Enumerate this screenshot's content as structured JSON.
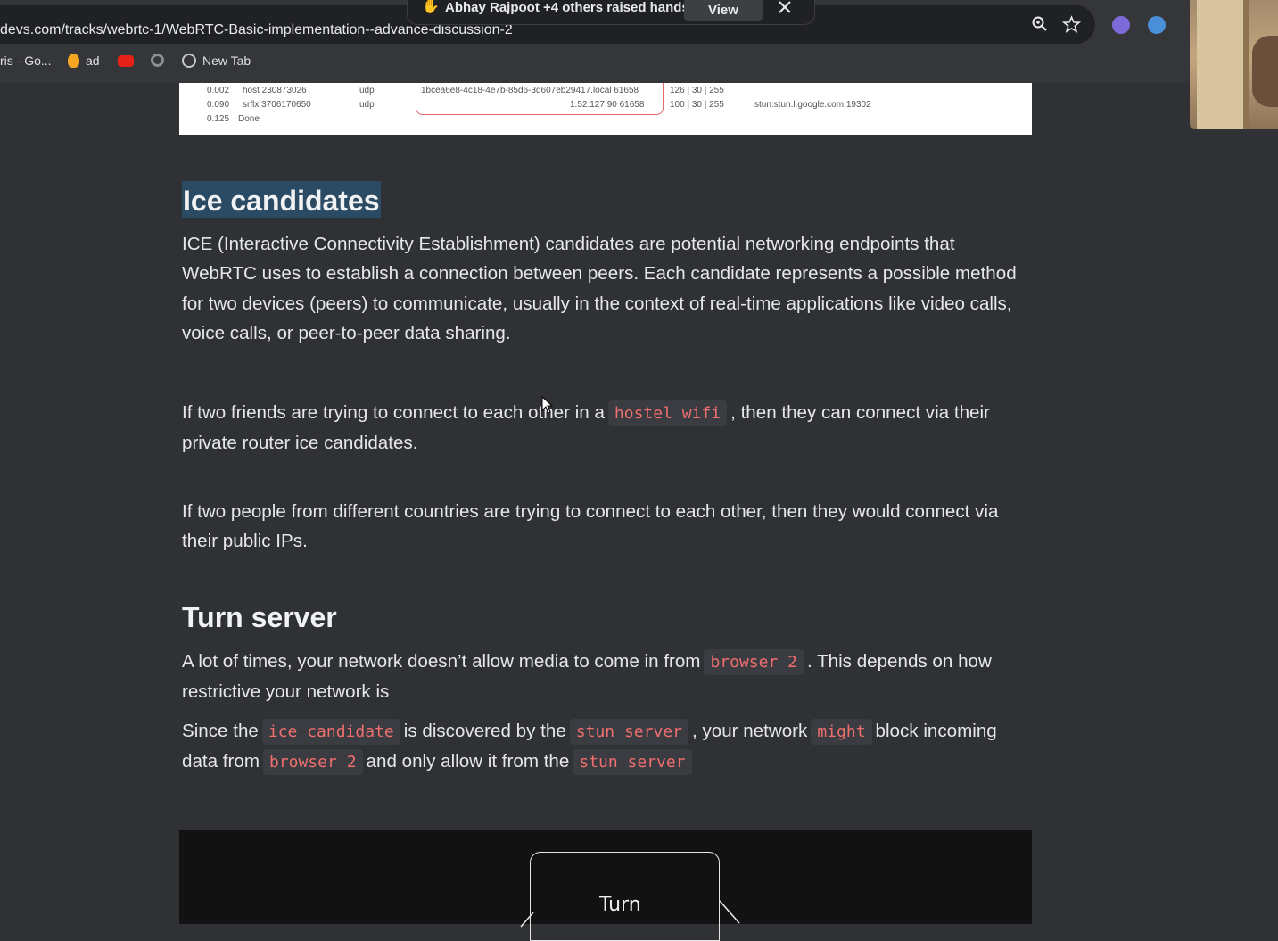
{
  "notification": {
    "text": "Abhay Rajpoot +4 others raised hands",
    "view_label": "View"
  },
  "browser": {
    "url": "devs.com/tracks/webrtc-1/WebRTC-Basic-implementation--advance-discussion-2",
    "bookmarks": [
      {
        "label": "ris - Go...",
        "icon": "bookmark-icon"
      },
      {
        "label": "ad",
        "icon": "flame-icon"
      },
      {
        "label": "",
        "icon": "youtube-icon"
      },
      {
        "label": "",
        "icon": "gear-icon"
      },
      {
        "label": "New Tab",
        "icon": "globe-icon"
      }
    ]
  },
  "ice_table": {
    "rows": [
      {
        "time": "0.002",
        "type": "host 230873026",
        "proto": "udp",
        "address": "1bcea6e8-4c18-4e7b-85d6-3d607eb29417.local 61658",
        "priority": "126 | 30 | 255",
        "server": ""
      },
      {
        "time": "0.090",
        "type": "srflx 3706170650",
        "proto": "udp",
        "address": "1.52.127.90 61658",
        "priority": "100 | 30 | 255",
        "server": "stun:stun.l.google.com:19302"
      },
      {
        "time": "0.125",
        "type": "Done",
        "proto": "",
        "address": "",
        "priority": "",
        "server": ""
      }
    ]
  },
  "article": {
    "ice_heading": "Ice candidates",
    "ice_para": "ICE (Interactive Connectivity Establishment) candidates are potential networking endpoints that WebRTC uses to establish a connection between peers. Each candidate represents a possible method for two devices (peers) to communicate, usually in the context of real-time applications like video calls, voice calls, or peer-to-peer data sharing.",
    "friends_para": {
      "before": "If two friends are trying to connect to each other in a",
      "code": "hostel wifi",
      "after": ", then they can connect via their private router ice candidates."
    },
    "countries_para": "If two people from different countries are trying to connect to each other, then they would connect via their public IPs.",
    "turn_heading": "Turn server",
    "turn_para1": {
      "before": "A lot of times, your network doesn’t allow media to come in from",
      "code": "browser 2",
      "after": ". This depends on how restrictive your network is"
    },
    "turn_para2": {
      "t1": "Since the",
      "c1": "ice candidate",
      "t2": "is discovered by the",
      "c2": "stun server",
      "t3": ", your network",
      "c3": "might",
      "t4": "block incoming data from",
      "c4": "browser 2",
      "t5": "and only allow it from the",
      "c5": "stun server"
    },
    "diagram_label": "Turn"
  }
}
